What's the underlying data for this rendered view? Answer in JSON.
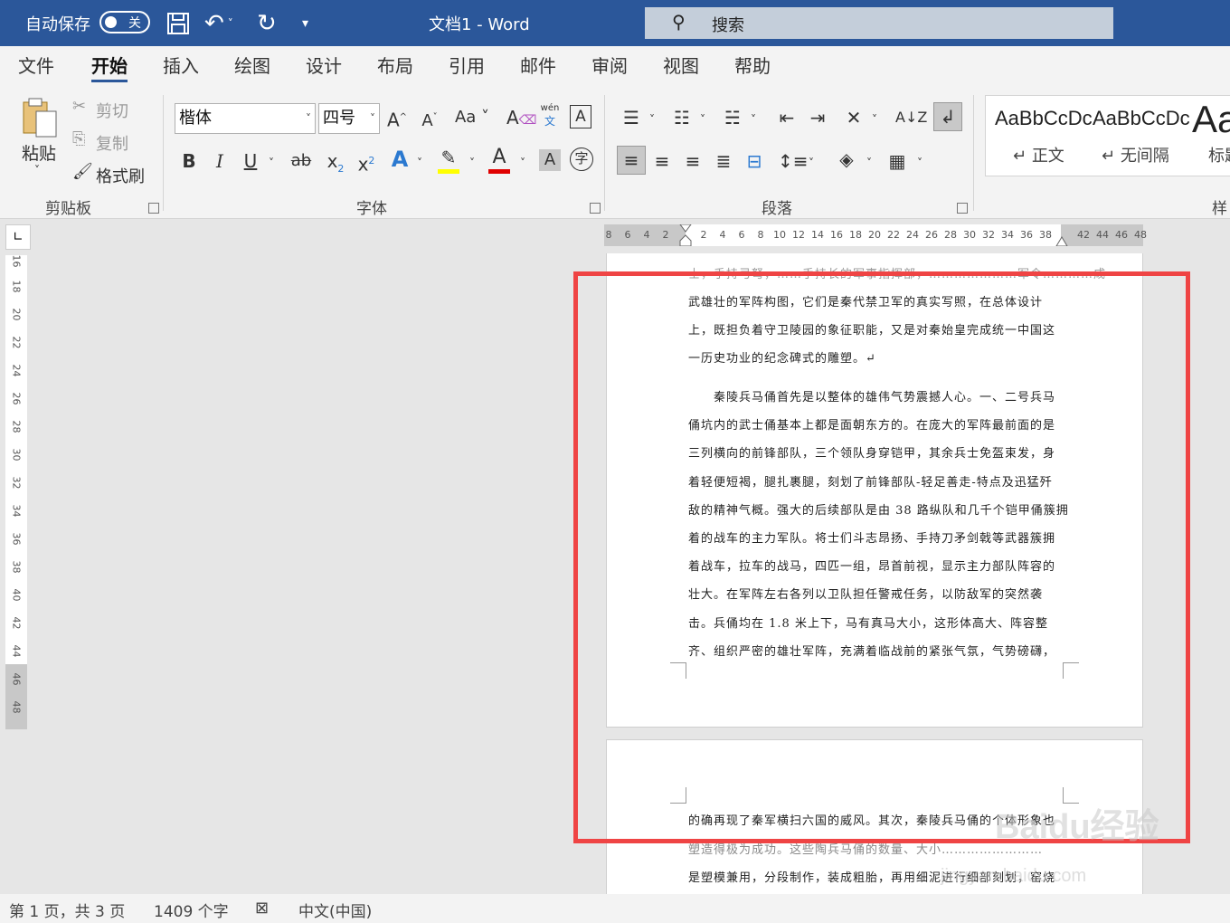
{
  "titlebar": {
    "autosave_label": "自动保存",
    "toggle_state": "关",
    "doc_title": "文档1  -  Word",
    "search_label": "搜索"
  },
  "menu": {
    "tabs": [
      "文件",
      "开始",
      "插入",
      "绘图",
      "设计",
      "布局",
      "引用",
      "邮件",
      "审阅",
      "视图",
      "帮助"
    ],
    "active": "开始"
  },
  "clipboard": {
    "paste": "粘贴",
    "cut": "剪切",
    "copy": "复制",
    "format_painter": "格式刷",
    "group": "剪贴板"
  },
  "font": {
    "name": "楷体",
    "size": "四号",
    "grow": "A^",
    "shrink": "A˅",
    "case": "Aa",
    "phonetic_top": "wén",
    "phonetic_bottom": "文",
    "group": "字体"
  },
  "paragraph": {
    "group": "段落"
  },
  "styles": {
    "items": [
      {
        "sample": "AaBbCcDc",
        "name": "正文"
      },
      {
        "sample": "AaBbCcDc",
        "name": "无间隔"
      },
      {
        "sample": "Aa",
        "name": "标题"
      }
    ],
    "group": "样"
  },
  "ruler": {
    "h_left": [
      "8",
      "6",
      "4",
      "2"
    ],
    "h_main": [
      "2",
      "4",
      "6",
      "8",
      "10",
      "12",
      "14",
      "16",
      "18",
      "20",
      "22",
      "24",
      "26",
      "28",
      "30",
      "32",
      "34",
      "36",
      "38"
    ],
    "h_right": [
      "42",
      "44",
      "46",
      "48"
    ],
    "v": [
      "16",
      "18",
      "20",
      "22",
      "24",
      "26",
      "28",
      "30",
      "32",
      "34",
      "36",
      "38",
      "40",
      "42",
      "44",
      "46",
      "48"
    ]
  },
  "document": {
    "page1_lines": [
      "士，手持弓弩，……手持长的军事指挥部，…………………军令…………成",
      "武雄壮的军阵构图，它们是秦代禁卫军的真实写照，在总体设计",
      "上，既担负着守卫陵园的象征职能，又是对秦始皇完成统一中国这",
      "一历史功业的纪念碑式的雕塑。↵",
      "　　秦陵兵马俑首先是以整体的雄伟气势震撼人心。一、二号兵马",
      "俑坑内的武士俑基本上都是面朝东方的。在庞大的军阵最前面的是",
      "三列横向的前锋部队，三个领队身穿铠甲，其余兵士免盔束发，身",
      "着轻便短褐，腿扎裹腿，刻划了前锋部队-轻足善走-特点及迅猛歼",
      "敌的精神气概。强大的后续部队是由 38 路纵队和几千个铠甲俑簇拥",
      "着的战车的主力军队。将士们斗志昂扬、手持刀矛剑戟等武器簇拥",
      "着战车，拉车的战马，四匹一组，昂首前视，显示主力部队阵容的",
      "壮大。在军阵左右各列以卫队担任警戒任务，以防敌军的突然袭",
      "击。兵俑均在 1.8 米上下，马有真马大小，这形体高大、阵容整",
      "齐、组织严密的雄壮军阵，充满着临战前的紧张气氛，气势磅礴，"
    ],
    "page2_lines": [
      "的确再现了秦军横扫六国的威风。其次，秦陵兵马俑的个体形象也",
      "塑造得极为成功。这些陶兵马俑的数量、大小……………………",
      "是塑模兼用，分段制作，装成粗胎，再用细泥进行细部刻划，窑烧"
    ]
  },
  "status": {
    "page": "第 1 页，共 3 页",
    "words": "1409 个字",
    "lang": "中文(中国)"
  },
  "watermark": {
    "text": "Baidu经验",
    "url": "jingyan.baidu.com"
  },
  "colors": {
    "title_bg": "#2b579a",
    "ribbon_bg": "#f3f3f3",
    "highlight_box": "#ef4444"
  }
}
